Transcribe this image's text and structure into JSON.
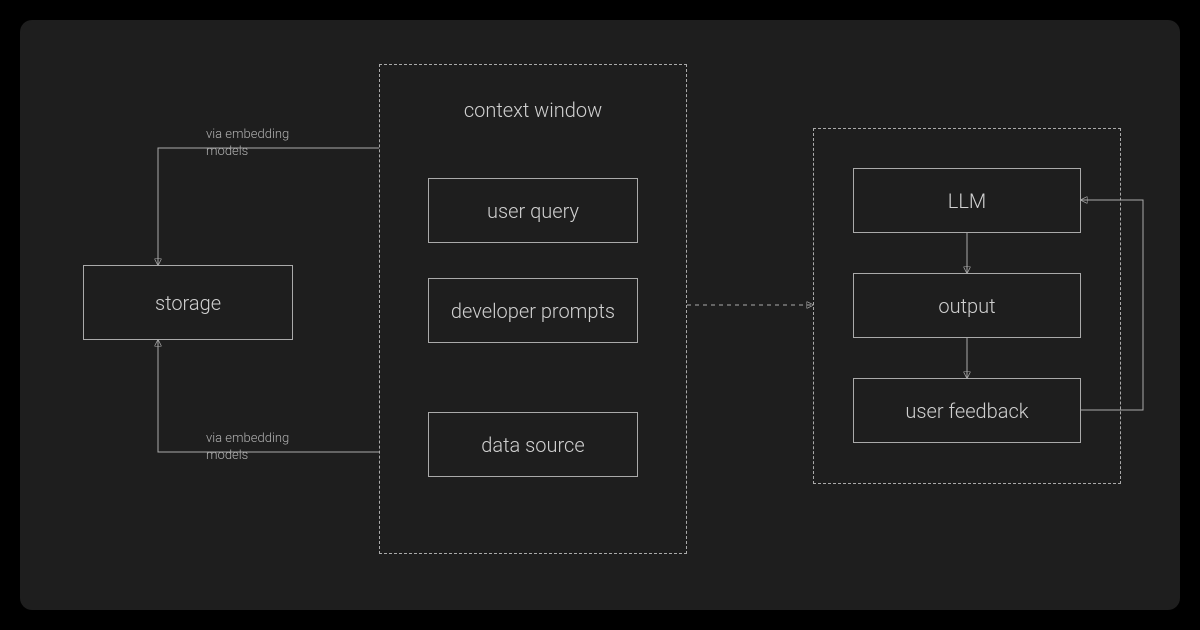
{
  "storage": {
    "label": "storage"
  },
  "edges": {
    "top": "via embedding\nmodels",
    "bottom": "via embedding\nmodels"
  },
  "context": {
    "title": "context window",
    "items": [
      "user query",
      "developer prompts",
      "data source"
    ]
  },
  "right": {
    "items": [
      "LLM",
      "output",
      "user feedback"
    ]
  }
}
